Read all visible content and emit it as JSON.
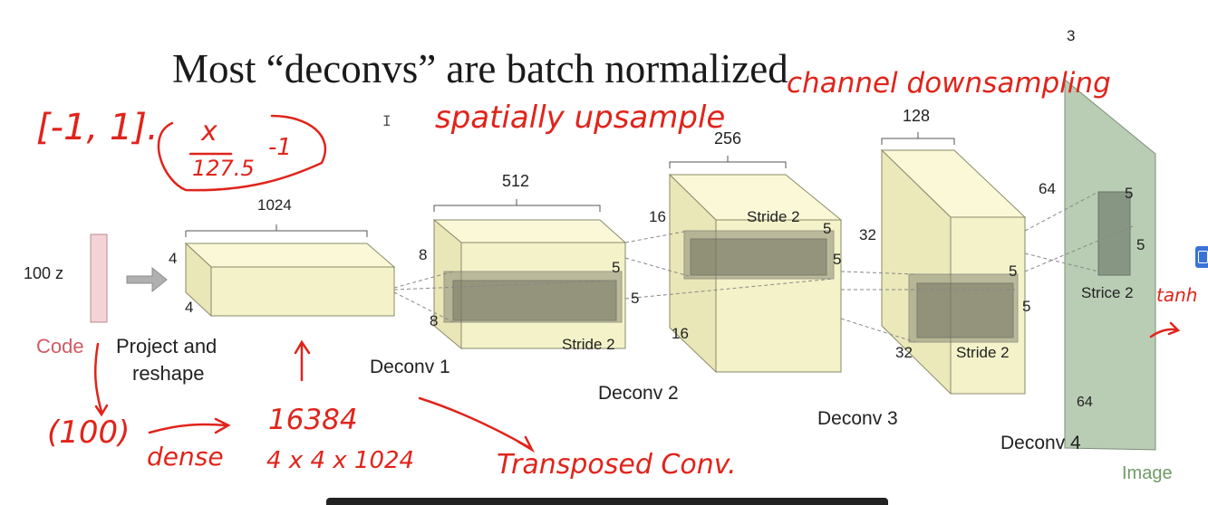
{
  "title": "Most “deconvs” are batch normalized",
  "input": {
    "size_label": "100 z",
    "code_label": "Code",
    "project_label_1": "Project and",
    "project_label_2": "reshape"
  },
  "layers": {
    "project": {
      "width_label": "1024",
      "height_label": "4",
      "depth_label": "4"
    },
    "deconv1": {
      "name": "Deconv 1",
      "width_label": "512",
      "height_label": "8",
      "depth_label": "8",
      "kernel_a": "5",
      "kernel_b": "5",
      "stride": "Stride 2"
    },
    "deconv2": {
      "name": "Deconv 2",
      "width_label": "256",
      "height_label": "16",
      "depth_label": "16",
      "kernel_a": "5",
      "kernel_b": "5",
      "stride": "Stride 2"
    },
    "deconv3": {
      "name": "Deconv 3",
      "width_label": "128",
      "height_label": "32",
      "depth_label": "32",
      "kernel_a": "5",
      "kernel_b": "5",
      "stride": "Stride 2"
    },
    "deconv4": {
      "name": "Deconv 4",
      "width_label": "3",
      "height_label": "64",
      "depth_label": "64",
      "kernel_a": "5",
      "kernel_b": "5",
      "stride": "Strice 2",
      "output_label": "Image"
    }
  },
  "annotations": {
    "range": "[-1, 1].",
    "formula_num": "x",
    "formula_den": "127.5",
    "formula_minus": "-1",
    "spatial": "spatially upsample",
    "channel": "channel downsampling",
    "code_size": "(100)",
    "dense": "dense",
    "flat_size": "16384",
    "shape": "4 x 4 x 1024",
    "transposed": "Transposed Conv.",
    "tanh": "tanh"
  },
  "colors": {
    "ink": "#e0241b",
    "box_fill": "#f4f2c8",
    "box_edge": "#8a8a6a",
    "kernel_fill": "#7b7b66",
    "image_fill": "#b9cdb4",
    "code_bar": "#f3d3d5"
  }
}
